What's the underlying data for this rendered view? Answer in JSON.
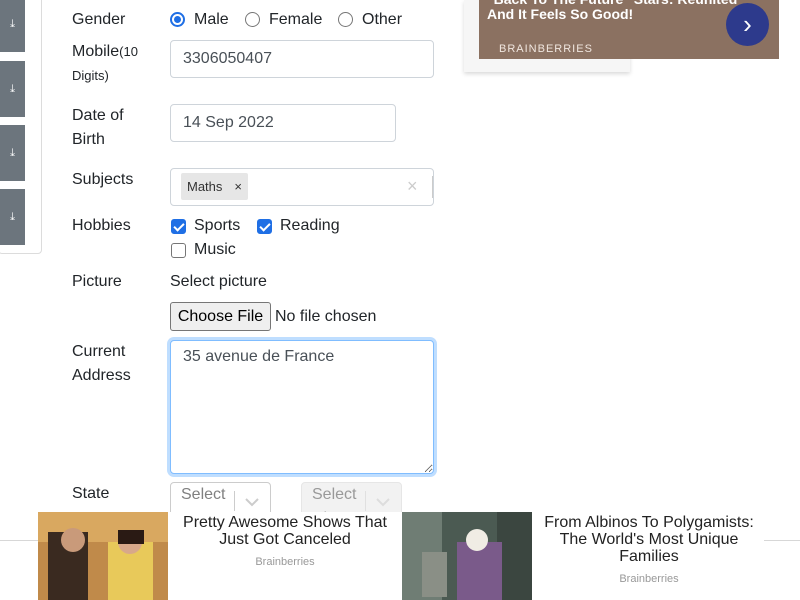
{
  "form": {
    "gender": {
      "label": "Gender",
      "options": [
        "Male",
        "Female",
        "Other"
      ],
      "selected": "Male"
    },
    "mobile": {
      "label": "Mobile",
      "hint": "(10 Digits)",
      "value": "3306050407"
    },
    "dob": {
      "label_line1": "Date of",
      "label_line2": "Birth",
      "value": "14 Sep 2022"
    },
    "subjects": {
      "label": "Subjects",
      "tags": [
        "Maths"
      ],
      "remove_glyph": "×",
      "clear_glyph": "×"
    },
    "hobbies": {
      "label": "Hobbies",
      "options": [
        {
          "name": "Sports",
          "checked": true
        },
        {
          "name": "Reading",
          "checked": true
        },
        {
          "name": "Music",
          "checked": false
        }
      ]
    },
    "picture": {
      "label": "Picture",
      "prompt": "Select picture",
      "button": "Choose File",
      "status": "No file chosen"
    },
    "address": {
      "label_line1": "Current",
      "label_line2": "Address",
      "value": "35 avenue de France"
    },
    "state_city": {
      "label": "State",
      "state_placeholder": "Select State",
      "city_placeholder": "Select City"
    }
  },
  "ads": {
    "top": {
      "headline": "\"Back To The Future\" Stars: Reunited And It Feels So Good!",
      "source": "BRAINBERRIES",
      "arrow": "›"
    },
    "bottom": [
      {
        "title": "Pretty Awesome Shows That Just Got Canceled",
        "source": "Brainberries"
      },
      {
        "title": "From Albinos To Polygamists: The World's Most Unique Families",
        "source": "Brainberries"
      }
    ]
  },
  "sidebar": {
    "icon": "download-icon",
    "glyph": "⤓"
  },
  "colors": {
    "accent": "#1f6fe5",
    "sidebar_button": "#6c757d",
    "ad_top_bg": "#8b7161",
    "ad_arrow_bg": "#2d3a8c"
  }
}
